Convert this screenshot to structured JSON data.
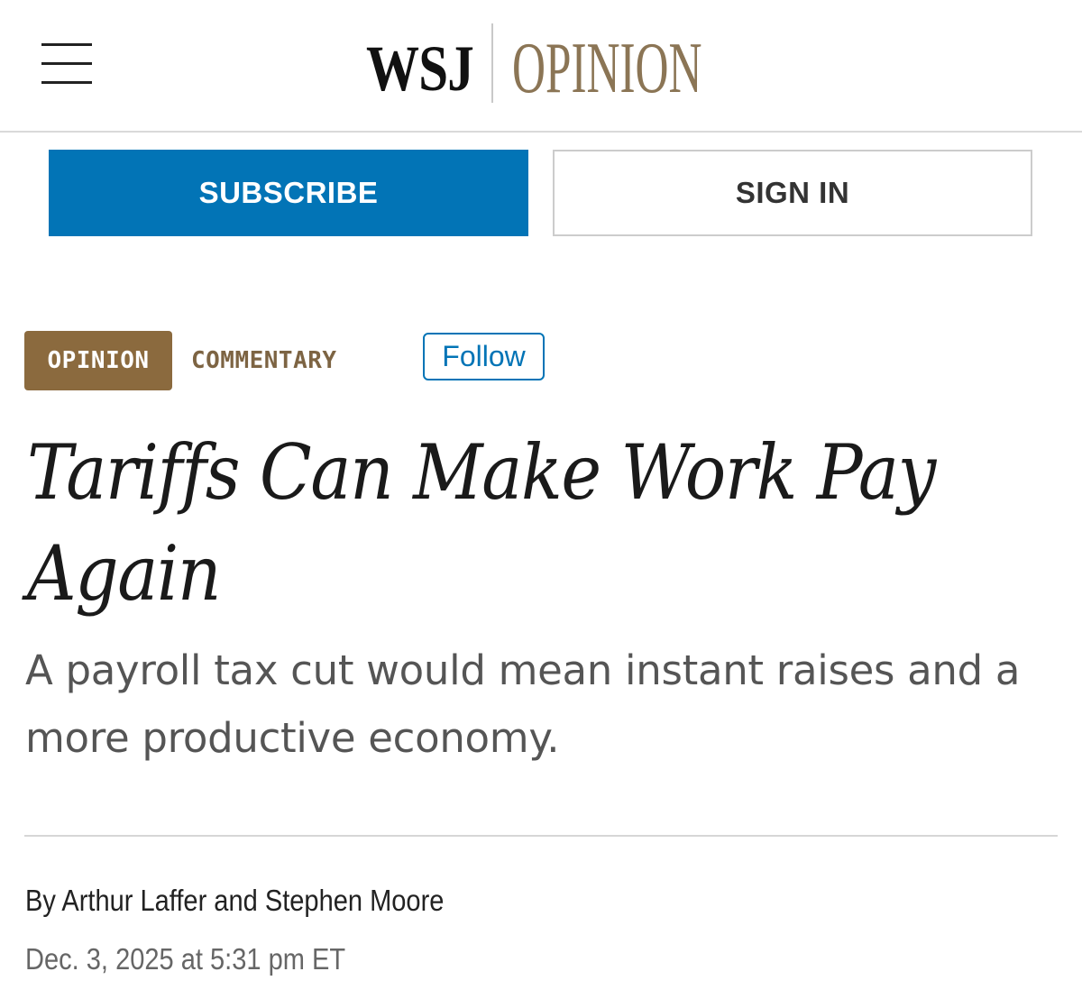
{
  "header": {
    "menu_icon": "hamburger-menu-icon",
    "logo_primary": "WSJ",
    "logo_section": "OPINION",
    "logo_section_color": "#8b7555"
  },
  "auth": {
    "subscribe_label": "SUBSCRIBE",
    "signin_label": "SIGN IN",
    "subscribe_color": "#0274b6"
  },
  "article": {
    "section_tag": "OPINION",
    "subsection": "COMMENTARY",
    "follow_label": "Follow",
    "section_tag_color": "#8b6a3e",
    "headline": "Tariffs Can Make Work Pay Again",
    "dek": "A payroll tax cut would mean instant raises and a more productive economy.",
    "byline": "By Arthur Laffer and Stephen Moore",
    "date": "Dec. 3, 2025 at 5:31 pm ET"
  }
}
